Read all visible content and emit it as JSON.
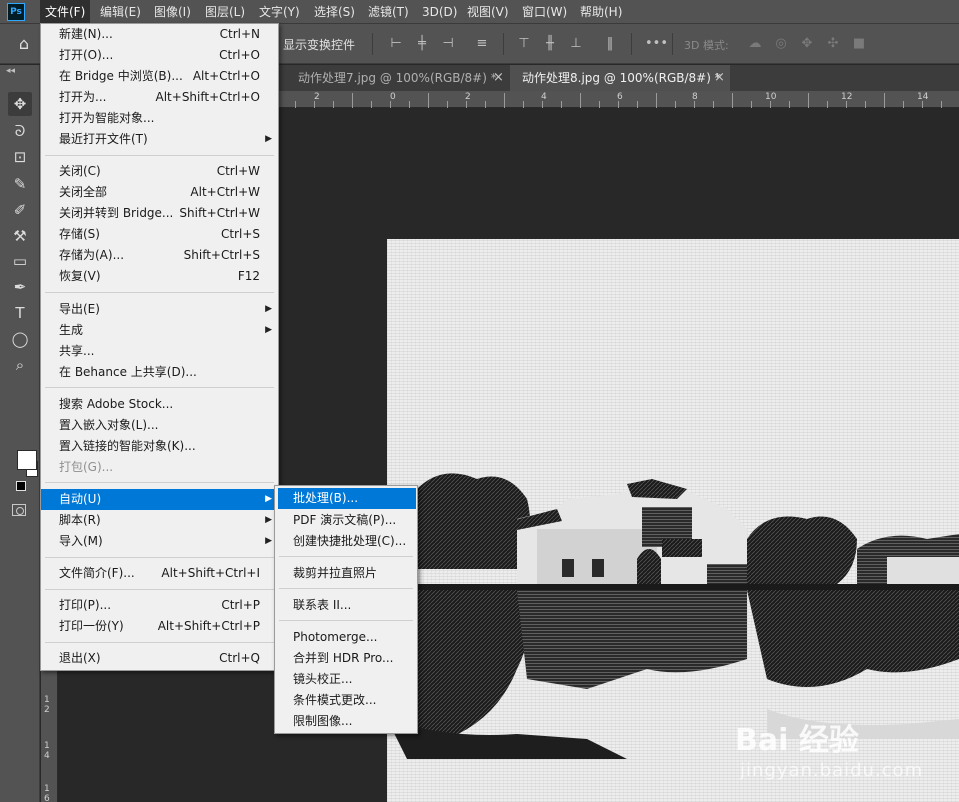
{
  "menubar": {
    "logo": "Ps",
    "items": [
      "文件(F)",
      "编辑(E)",
      "图像(I)",
      "图层(L)",
      "文字(Y)",
      "选择(S)",
      "滤镜(T)",
      "3D(D)",
      "视图(V)",
      "窗口(W)",
      "帮助(H)"
    ]
  },
  "options_bar": {
    "transform_label": "显示变换控件",
    "mode_3d_label": "3D 模式:",
    "more_label": "•••"
  },
  "tabs": [
    {
      "label": "动作处理7.jpg @ 100%(RGB/8#) *",
      "close": "×",
      "active": false
    },
    {
      "label": "动作处理8.jpg @ 100%(RGB/8#) *",
      "close": "×",
      "active": true
    }
  ],
  "ruler": {
    "h_numbers": [
      "2",
      "0",
      "2",
      "4",
      "6",
      "8",
      "10",
      "12",
      "14"
    ],
    "v_numbers": [
      "1\n2",
      "1\n4",
      "1\n6"
    ]
  },
  "file_menu": {
    "items": [
      {
        "label": "新建(N)...",
        "shortcut": "Ctrl+N"
      },
      {
        "label": "打开(O)...",
        "shortcut": "Ctrl+O"
      },
      {
        "label": "在 Bridge 中浏览(B)...",
        "shortcut": "Alt+Ctrl+O"
      },
      {
        "label": "打开为...",
        "shortcut": "Alt+Shift+Ctrl+O"
      },
      {
        "label": "打开为智能对象..."
      },
      {
        "label": "最近打开文件(T)"
      },
      {
        "label": "关闭(C)",
        "shortcut": "Ctrl+W"
      },
      {
        "label": "关闭全部",
        "shortcut": "Alt+Ctrl+W"
      },
      {
        "label": "关闭并转到 Bridge...",
        "shortcut": "Shift+Ctrl+W"
      },
      {
        "label": "存储(S)",
        "shortcut": "Ctrl+S"
      },
      {
        "label": "存储为(A)...",
        "shortcut": "Shift+Ctrl+S"
      },
      {
        "label": "恢复(V)",
        "shortcut": "F12"
      },
      {
        "label": "导出(E)"
      },
      {
        "label": "生成"
      },
      {
        "label": "共享..."
      },
      {
        "label": "在 Behance 上共享(D)..."
      },
      {
        "label": "搜索 Adobe Stock..."
      },
      {
        "label": "置入嵌入对象(L)..."
      },
      {
        "label": "置入链接的智能对象(K)..."
      },
      {
        "label": "打包(G)..."
      },
      {
        "label": "自动(U)"
      },
      {
        "label": "脚本(R)"
      },
      {
        "label": "导入(M)"
      },
      {
        "label": "文件简介(F)...",
        "shortcut": "Alt+Shift+Ctrl+I"
      },
      {
        "label": "打印(P)...",
        "shortcut": "Ctrl+P"
      },
      {
        "label": "打印一份(Y)",
        "shortcut": "Alt+Shift+Ctrl+P"
      },
      {
        "label": "退出(X)",
        "shortcut": "Ctrl+Q"
      }
    ]
  },
  "auto_submenu": {
    "items": [
      "批处理(B)...",
      "PDF 演示文稿(P)...",
      "创建快捷批处理(C)...",
      "裁剪并拉直照片",
      "联系表 II...",
      "Photomerge...",
      "合并到 HDR Pro...",
      "镜头校正...",
      "条件模式更改...",
      "限制图像..."
    ]
  },
  "watermark": {
    "text": "Bai 经验",
    "url": "jingyan.baidu.com"
  },
  "colors": {
    "ui_bar": "#535353",
    "canvas_bg": "#282828",
    "menu_bg": "#f0f0f0",
    "highlight": "#0078d7"
  }
}
